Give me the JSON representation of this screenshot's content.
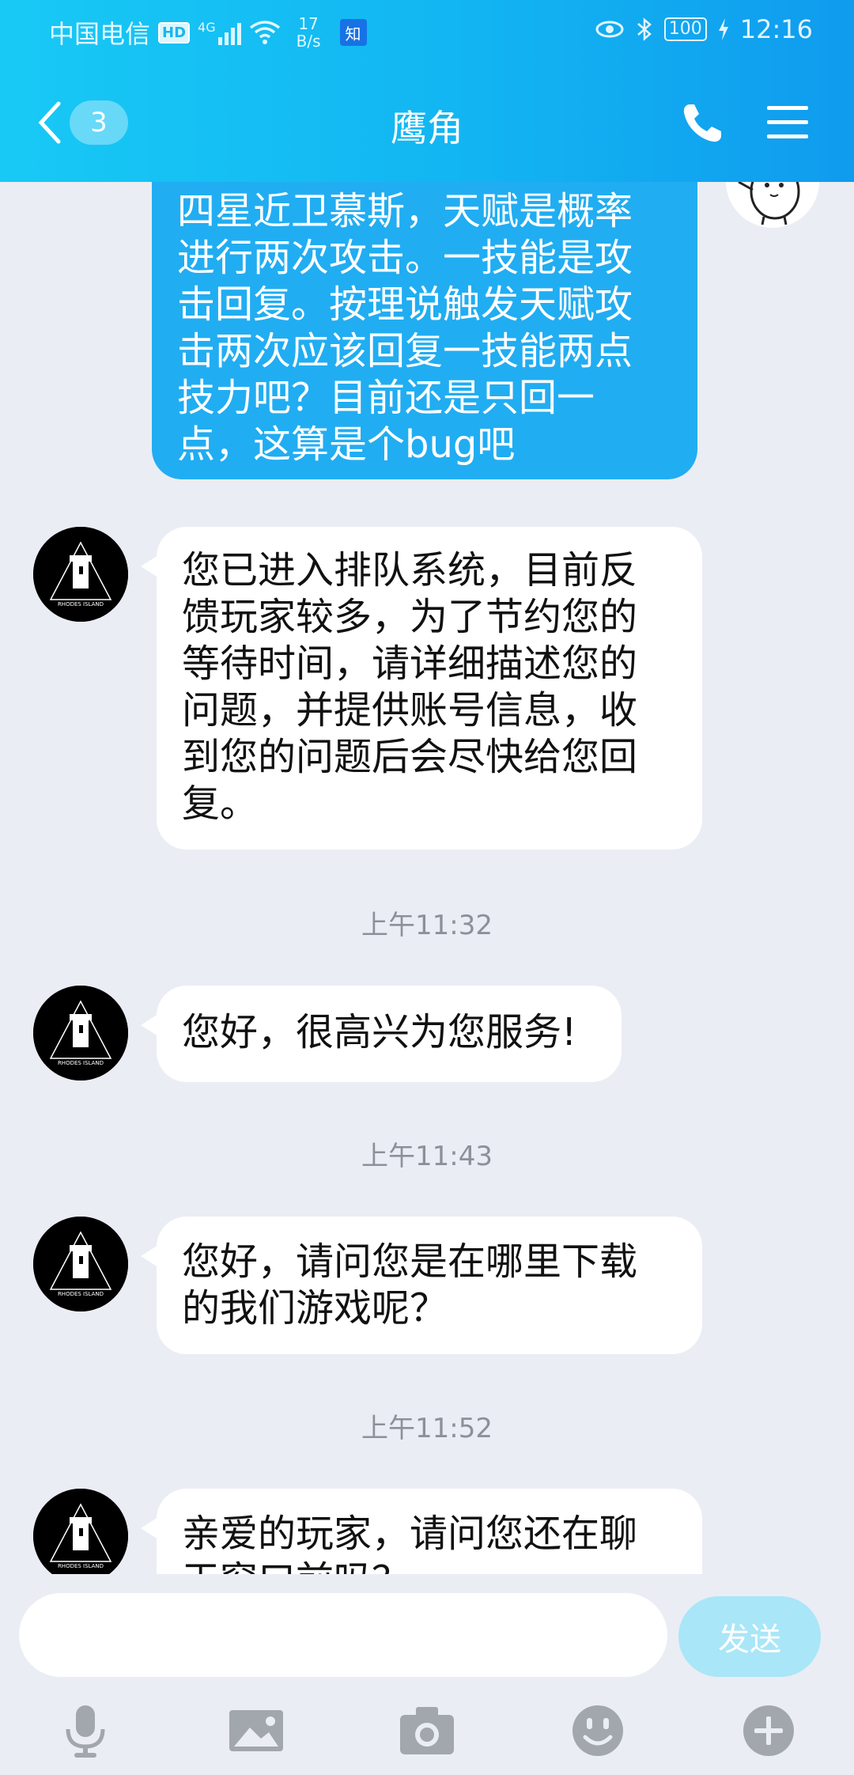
{
  "status_bar": {
    "carrier": "中国电信",
    "hd": "HD",
    "network": "4G",
    "speed_value": "17",
    "speed_unit": "B/s",
    "app_badge": "知",
    "battery": "100",
    "time": "12:16"
  },
  "header": {
    "unread_count": "3",
    "title": "鹰角"
  },
  "messages": [
    {
      "side": "out",
      "text": "四星近卫慕斯，天赋是概率进行两次攻击。一技能是攻击回复。按理说触发天赋攻击两次应该回复一技能两点技力吧？目前还是只回一点，这算是个bug吧"
    },
    {
      "side": "in",
      "text": "您已进入排队系统，目前反馈玩家较多，为了节约您的等待时间，请详细描述您的问题，并提供账号信息，收到您的问题后会尽快给您回复。"
    },
    {
      "timestamp": "上午11:32"
    },
    {
      "side": "in",
      "text": "您好，很高兴为您服务!"
    },
    {
      "timestamp": "上午11:43"
    },
    {
      "side": "in",
      "text": "您好，请问您是在哪里下载的我们游戏呢？"
    },
    {
      "timestamp": "上午11:52"
    },
    {
      "side": "in",
      "text": "亲爱的玩家，请问您还在聊天窗口前吗？"
    }
  ],
  "avatar_label": "RHODES ISLAND",
  "input": {
    "placeholder": "",
    "value": "",
    "send_label": "发送"
  },
  "toolbar": [
    "microphone-icon",
    "image-icon",
    "camera-icon",
    "emoji-icon",
    "plus-icon"
  ],
  "colors": {
    "header_start": "#18c9f5",
    "header_end": "#109bee",
    "outgoing_bubble": "#21adf2",
    "incoming_bubble": "#ffffff",
    "background": "#eaedf4",
    "send_button": "#a9e6f8",
    "icon_gray": "#a2a6ad"
  }
}
